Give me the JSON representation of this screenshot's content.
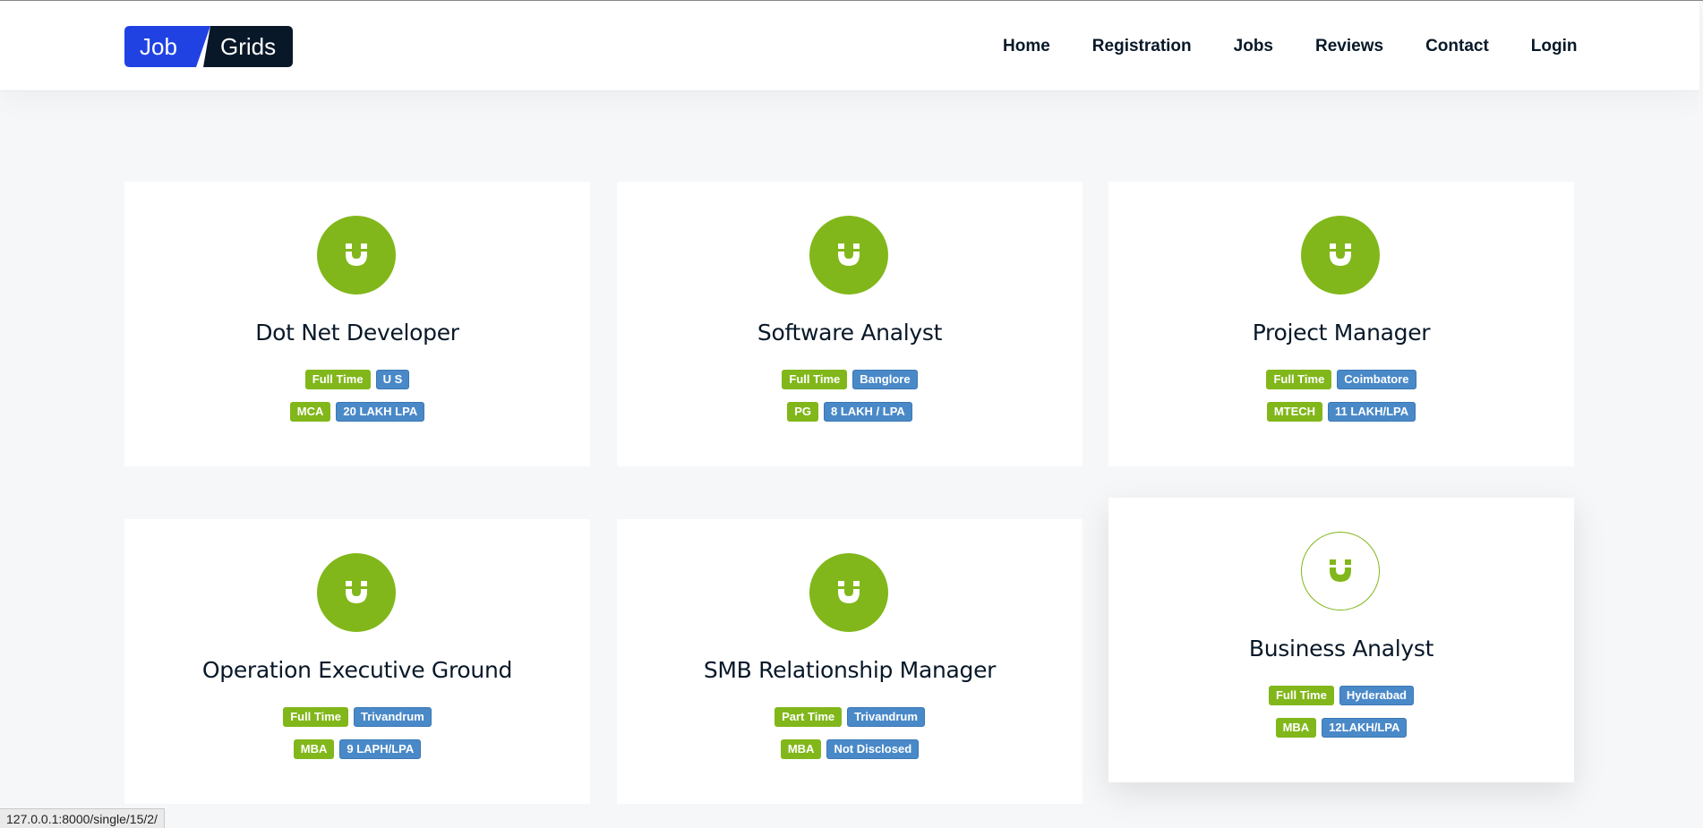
{
  "brand": {
    "part1": "Job",
    "part2": "Grids",
    "color_primary": "#2042e3",
    "color_dark": "#081828"
  },
  "nav": {
    "items": [
      {
        "label": "Home"
      },
      {
        "label": "Registration"
      },
      {
        "label": "Jobs"
      },
      {
        "label": "Reviews"
      },
      {
        "label": "Contact"
      },
      {
        "label": "Login"
      }
    ]
  },
  "jobs": [
    {
      "title": "Dot Net Developer",
      "type": "Full Time",
      "location": "U S",
      "qualification": "MCA",
      "salary": "20 LAKH LPA"
    },
    {
      "title": "Software Analyst",
      "type": "Full Time",
      "location": "Banglore",
      "qualification": "PG",
      "salary": "8 LAKH / LPA"
    },
    {
      "title": "Project Manager",
      "type": "Full Time",
      "location": "Coimbatore",
      "qualification": "MTECH",
      "salary": "11 LAKH/LPA"
    },
    {
      "title": "Operation Executive Ground",
      "type": "Full Time",
      "location": "Trivandrum",
      "qualification": "MBA",
      "salary": "9 LAPH/LPA"
    },
    {
      "title": "SMB Relationship Manager",
      "type": "Part Time",
      "location": "Trivandrum",
      "qualification": "MBA",
      "salary": "Not Disclosed"
    },
    {
      "title": "Business Analyst",
      "type": "Full Time",
      "location": "Hyderabad",
      "qualification": "MBA",
      "salary": "12LAKH/LPA"
    }
  ],
  "job_icon": "magnet-icon",
  "colors": {
    "accent_green": "#81b71a",
    "tag_blue": "#4a89c8"
  },
  "statusbar": {
    "url": "127.0.0.1:8000/single/15/2/"
  }
}
